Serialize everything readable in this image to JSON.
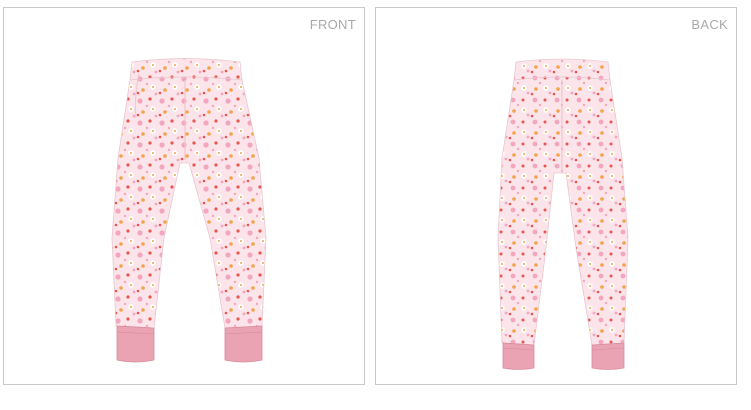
{
  "views": {
    "front": {
      "label": "FRONT"
    },
    "back": {
      "label": "BACK"
    }
  },
  "colors": {
    "fabric": "#fbe4ea",
    "cuff": "#e9a3b2",
    "cuff_shadow": "#d98b9d",
    "print_pink": "#f3a6bd",
    "print_red": "#e9564b",
    "print_orange": "#f2a44a",
    "print_white": "#ffffff",
    "panel_border": "#c9c9c9",
    "label_text": "#a9a9a9"
  }
}
